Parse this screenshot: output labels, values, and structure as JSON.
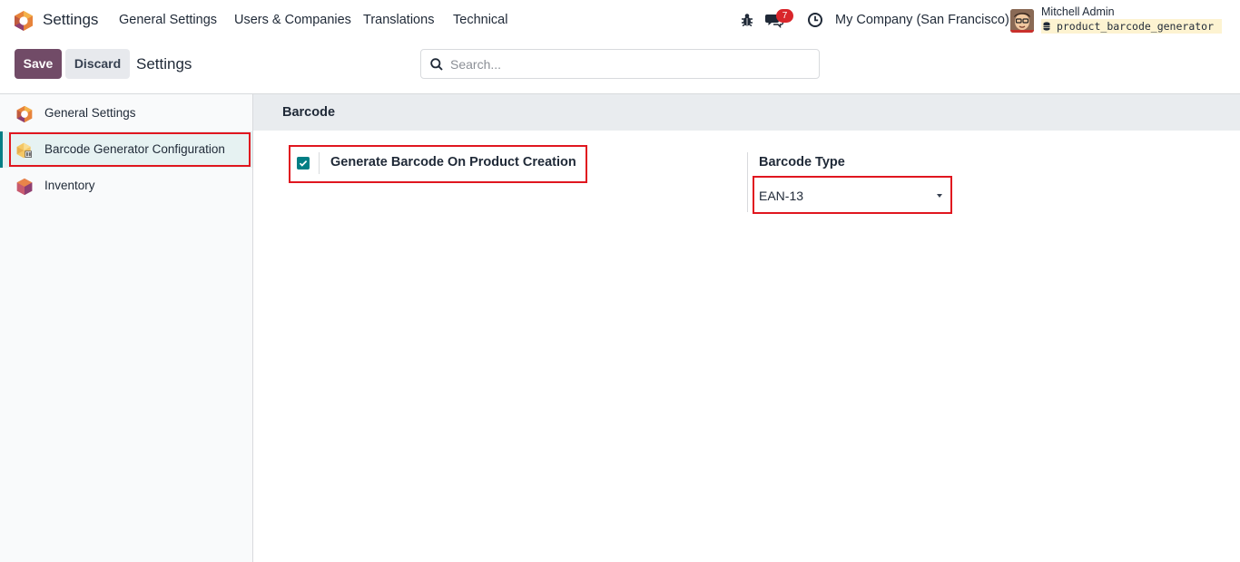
{
  "navbar": {
    "app_name": "Settings",
    "menus": [
      "General Settings",
      "Users & Companies",
      "Translations",
      "Technical"
    ],
    "messages_badge": "7",
    "company": "My Company (San Francisco)",
    "user_name": "Mitchell Admin",
    "database": "product_barcode_generator"
  },
  "control_panel": {
    "save_label": "Save",
    "discard_label": "Discard",
    "breadcrumb": "Settings",
    "search_placeholder": "Search..."
  },
  "sidebar": {
    "items": [
      {
        "label": "General Settings",
        "icon": "settings-app-icon"
      },
      {
        "label": "Barcode Generator Configuration",
        "icon": "barcode-module-icon",
        "active": true
      },
      {
        "label": "Inventory",
        "icon": "inventory-app-icon"
      }
    ]
  },
  "main": {
    "section_title": "Barcode",
    "generate_barcode": {
      "label": "Generate Barcode On Product Creation",
      "checked": true
    },
    "barcode_type": {
      "label": "Barcode Type",
      "value": "EAN-13"
    }
  },
  "colors": {
    "brand": "#714b67",
    "accent": "#017e84",
    "highlight": "#e0161f"
  }
}
